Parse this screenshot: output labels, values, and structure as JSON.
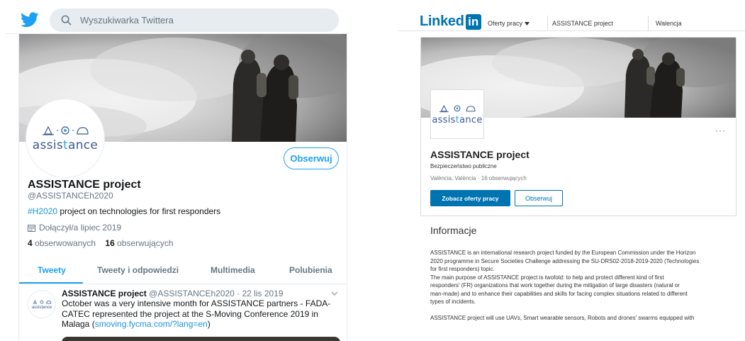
{
  "twitter": {
    "search_placeholder": "Wyszukiwarka Twittera",
    "follow_label": "Obserwuj",
    "profile_name": "ASSISTANCE project",
    "handle": "@ASSISTANCEh2020",
    "bio_hashtag": "#H2020",
    "bio_rest": " project on technologies for first responders",
    "joined": "Dołączył/a lipiec 2019",
    "following_count": "4",
    "following_label": " obserwowanych",
    "followers_count": "16",
    "followers_label": " obserwujących",
    "tabs": [
      {
        "label": "Tweety"
      },
      {
        "label": "Tweety i odpowiedzi"
      },
      {
        "label": "Multimedia"
      },
      {
        "label": "Polubienia"
      }
    ],
    "tweet": {
      "author": "ASSISTANCE project",
      "meta": " @ASSISTANCEh2020 · 22 lis 2019",
      "text": "October was a very intensive month for ASSISTANCE partners - FADA-CATEC represented the project at the S-Moving Conference 2019 in Malaga (",
      "link": "smoving.fycma.com/?lang=en",
      "text_end": ")"
    },
    "logo_text_a": "assis",
    "logo_text_b": "t",
    "logo_text_c": "ance",
    "mini_logo_text": "assistance",
    "brand_color": "#1da1f2"
  },
  "linkedin": {
    "logo_word": "Linked",
    "logo_box": "in",
    "jobs_menu": "Oferty pracy",
    "search_value": "ASSISTANCE project",
    "location_value": "Walencja",
    "logo_text_a": "assis",
    "logo_text_b": "t",
    "logo_text_c": "ance",
    "more_dots": "···",
    "company_name": "ASSISTANCE project",
    "industry": "Bezpieczeństwo publiczne",
    "location_followers": "València, València · 16 obserwujących",
    "btn_jobs": "Zobacz oferty pracy",
    "btn_follow": "Obserwuj",
    "info_title": "Informacje",
    "about_lines": [
      "ASSISTANCE is an international research project funded by the European Commission under the Horizon",
      "2020 programme in Secure Societies Challenge addressing the SU-DRS02-2018-2019-2020 (Technologies",
      "for first responders) topic.",
      "The main purpose of ASSISTANCE project is twofold: to help and protect different kind of first",
      "responders' (FR) organizations that work together during the mitigation of large disasters (natural or",
      "man-made) and to enhance their capabilities and skills for facing complex situations related to different",
      "types of incidents."
    ],
    "about_last": "ASSISTANCE project will use UAVs, Smart wearable sensors, Robots and drones' swarms equipped with",
    "brand_color": "#0073b1"
  }
}
